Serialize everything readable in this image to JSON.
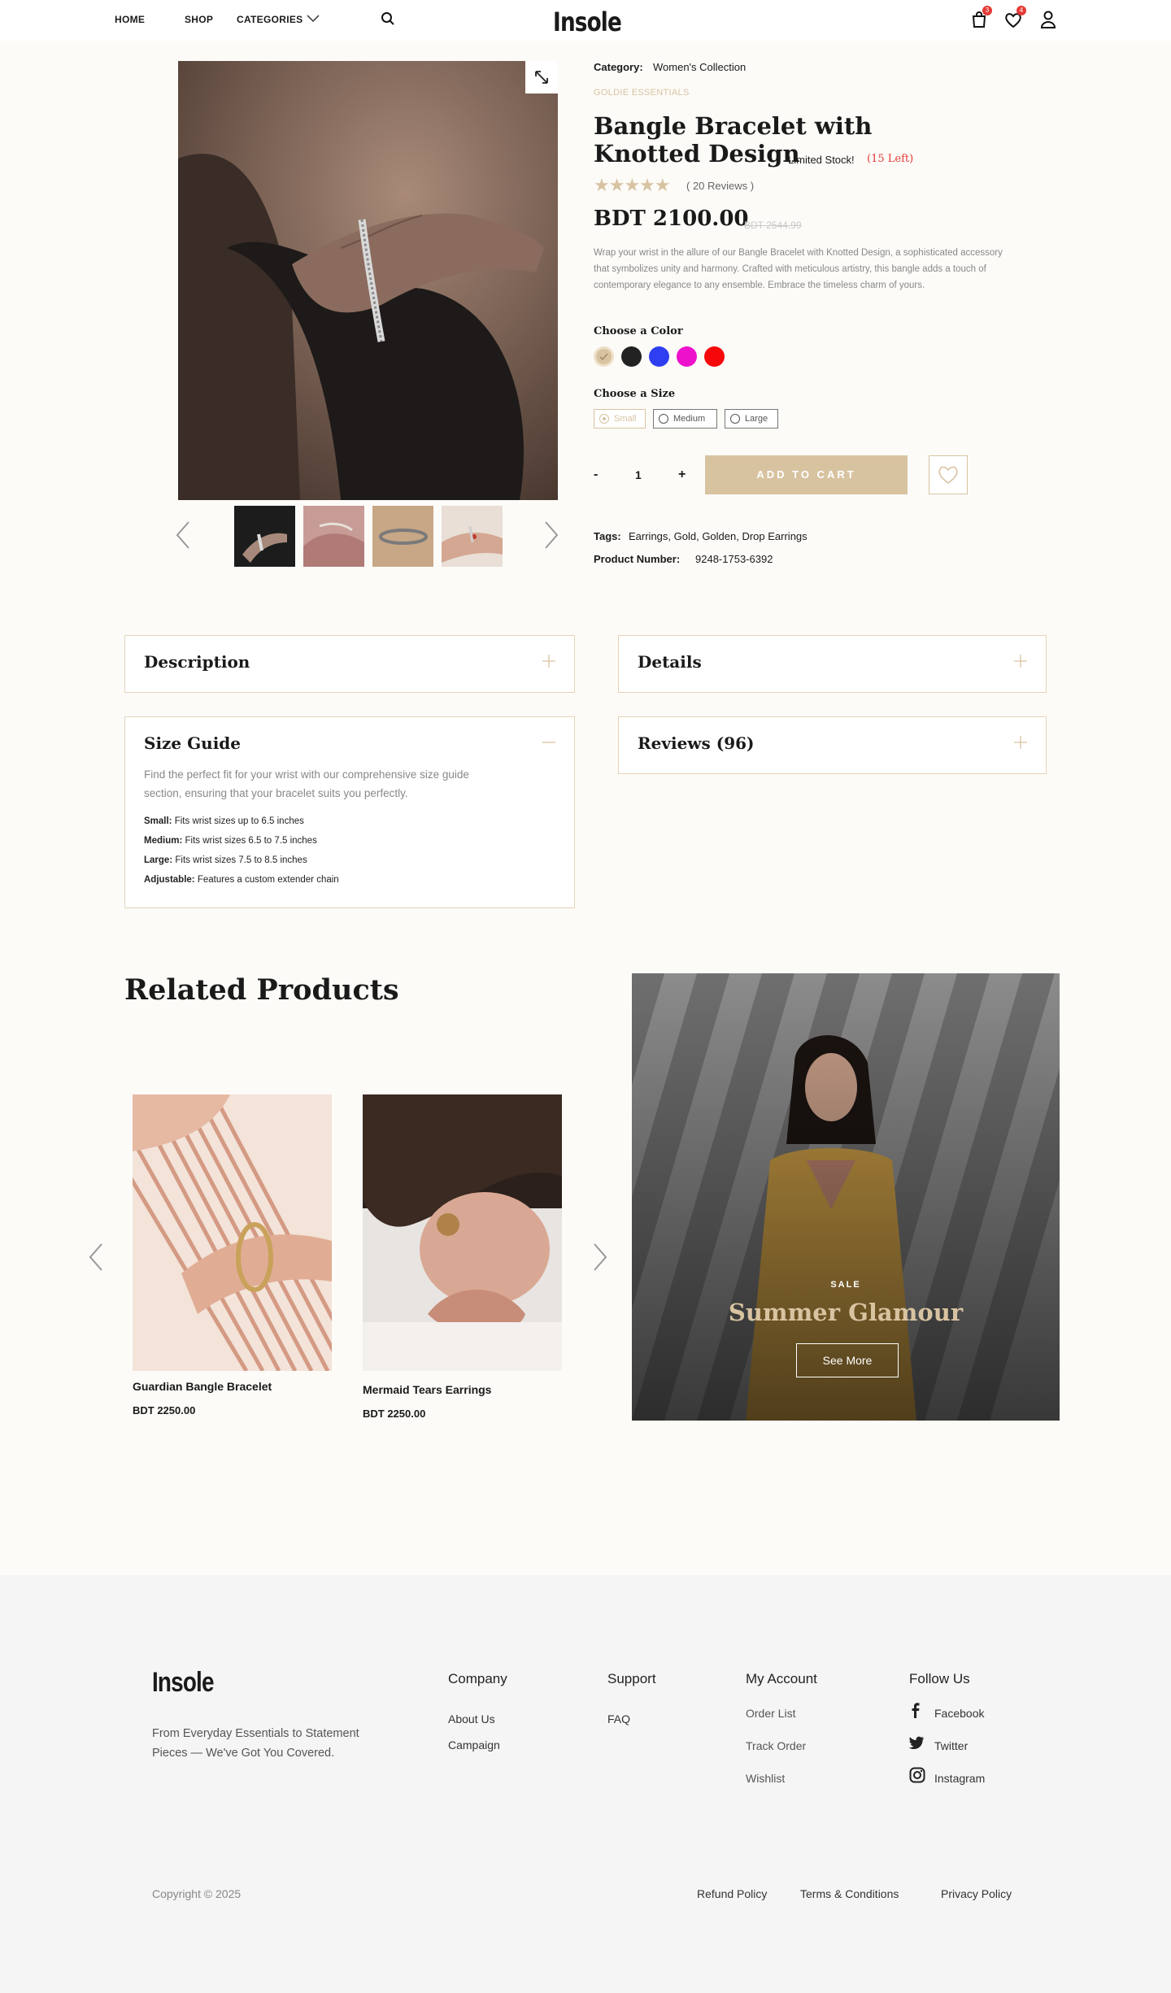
{
  "header": {
    "nav": [
      "HOME",
      "SHOP",
      "CATEGORIES"
    ],
    "logo": "Insole",
    "cart_count": "3",
    "wishlist_count": "4"
  },
  "product": {
    "category_label": "Category:",
    "category_value": "Women's Collection",
    "collection": "GOLDIE ESSENTIALS",
    "title_line1": "Bangle Bracelet with",
    "title_line2": "Knotted Design",
    "stock_label": "Limited Stock!",
    "stock_left": "(15 Left)",
    "rating": 5,
    "reviews_text": "( 20 Reviews )",
    "price": "BDT 2100.00",
    "old_price": "BDT 2544.99",
    "description": "Wrap your wrist in the allure of our Bangle Bracelet with Knotted Design, a sophisticated accessory that symbolizes unity and harmony. Crafted with meticulous artistry, this bangle adds a touch of contemporary elegance to any ensemble. Embrace the timeless charm of yours.",
    "color_label": "Choose a Color",
    "colors": [
      "#d8c3a1",
      "#222222",
      "#2e3ef0",
      "#ee11cc",
      "#f5070a"
    ],
    "size_label": "Choose a Size",
    "sizes": [
      "Small",
      "Medium",
      "Large"
    ],
    "selected_size": "Small",
    "quantity": "1",
    "qty_minus": "-",
    "qty_plus": "+",
    "add_to_cart": "ADD TO CART",
    "tags_label": "Tags:",
    "tags_value": "Earrings, Gold, Golden, Drop Earrings",
    "product_number_label": "Product Number:",
    "product_number_value": "9248-1753-6392"
  },
  "accordions": {
    "description": "Description",
    "details": "Details",
    "size_guide": "Size Guide",
    "reviews": "Reviews (96)",
    "size_guide_intro": "Find the perfect fit for your wrist with our comprehensive size guide section, ensuring that your bracelet suits you perfectly.",
    "size_guide_items": [
      {
        "label": "Small:",
        "text": "Fits wrist sizes up to 6.5 inches"
      },
      {
        "label": "Medium:",
        "text": "Fits wrist sizes 6.5 to 7.5 inches"
      },
      {
        "label": "Large:",
        "text": "Fits wrist sizes 7.5 to 8.5 inches"
      },
      {
        "label": "Adjustable:",
        "text": "Features a custom extender chain"
      }
    ]
  },
  "related": {
    "heading": "Related Products",
    "products": [
      {
        "name": "Guardian Bangle Bracelet",
        "price": "BDT 2250.00"
      },
      {
        "name": "Mermaid Tears Earrings",
        "price": "BDT 2250.00"
      }
    ],
    "banner": {
      "kicker": "SALE",
      "title": "Summer Glamour",
      "button": "See More"
    }
  },
  "footer": {
    "logo": "Insole",
    "tagline_line1": "From Everyday Essentials to Statement",
    "tagline_line2": "Pieces — We've Got You Covered.",
    "company_title": "Company",
    "company_links": [
      "About Us",
      "Campaign"
    ],
    "support_title": "Support",
    "support_links": [
      "FAQ"
    ],
    "account_title": "My Account",
    "account_links": [
      "Order List",
      "Track Order",
      "Wishlist"
    ],
    "follow_title": "Follow Us",
    "follow_links": [
      "Facebook",
      "Twitter",
      "Instagram"
    ],
    "copyright": "Copyright © 2025",
    "legal_links": [
      "Refund Policy",
      "Terms & Conditions",
      "Privacy Policy"
    ]
  }
}
